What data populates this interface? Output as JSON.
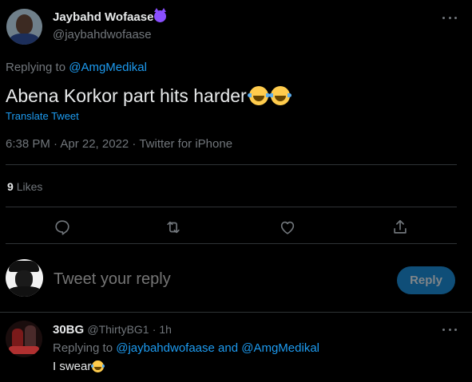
{
  "tweet": {
    "author_name": "Jaybahd Wofaase",
    "author_handle": "@jaybahdwofaase",
    "replying_prefix": "Replying to ",
    "replying_to": "@AmgMedikal",
    "text": "Abena Korkor part hits harder",
    "translate_label": "Translate Tweet",
    "meta": "6:38 PM · Apr 22, 2022 · Twitter for iPhone",
    "likes_count": "9",
    "likes_label": "Likes"
  },
  "compose": {
    "placeholder": "Tweet your reply",
    "reply_button": "Reply"
  },
  "reply": {
    "author_name": "30BG",
    "author_handle": "@ThirtyBG1",
    "time": "· 1h",
    "replying_prefix": "Replying to ",
    "replying_to_1": "@jaybahdwofaase",
    "replying_and": " and ",
    "replying_to_2": "@AmgMedikal",
    "text": "I swear"
  },
  "icons": [
    "more-icon",
    "reply-icon",
    "retweet-icon",
    "like-icon",
    "share-icon",
    "laughing-emoji-icon",
    "devil-emoji-icon"
  ],
  "colors": {
    "background": "#000000",
    "link": "#1d9bf0",
    "muted": "#71767b",
    "reply_button": "#0f4e78"
  }
}
